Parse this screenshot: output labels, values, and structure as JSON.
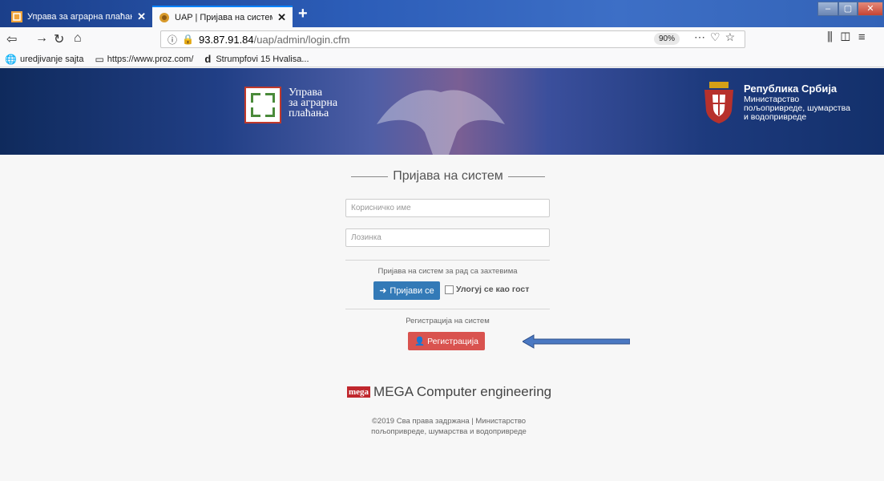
{
  "browser": {
    "tabs": [
      {
        "title": "Управа за аграрна плаћања | ...",
        "active": false
      },
      {
        "title": "UAP | Пријава на систем",
        "active": true
      }
    ],
    "new_tab": "+",
    "url_host": "93.87.91.84",
    "url_path": "/uap/admin/login.cfm",
    "zoom": "90%",
    "bookmarks": [
      {
        "label": "uredjivanje sajta",
        "icon": "globe-icon"
      },
      {
        "label": "https://www.proz.com/",
        "icon": "page-icon"
      },
      {
        "label": "Strumpfovi 15 Hvalisa...",
        "icon": "d-icon"
      }
    ]
  },
  "header": {
    "logo_line1": "Управа",
    "logo_line2": "за аграрна",
    "logo_line3": "плаћања",
    "republic": "Република Србија",
    "ministry_line1": "Министарство",
    "ministry_line2": "пољопривреде, шумарства",
    "ministry_line3": "и водопривреде"
  },
  "login": {
    "heading": "Пријава на систем",
    "username_placeholder": "Корисничко име",
    "password_placeholder": "Лозинка",
    "login_caption": "Пријава на систем за рад са захтевима",
    "login_button": "Пријави се",
    "guest_label": "Улогуј се као гост",
    "register_caption": "Регистрација на систем",
    "register_button": "Регистрација"
  },
  "footer": {
    "mega_badge": "mega",
    "mega_text": "MEGA Computer engineering",
    "copyright_line1": "©2019 Сва права задржана | Министарство",
    "copyright_line2": "пољопривреде, шумарства и водопривреде"
  },
  "colors": {
    "login_button": "#337ab7",
    "register_button": "#d9534f",
    "arrow": "#4a78c2"
  }
}
